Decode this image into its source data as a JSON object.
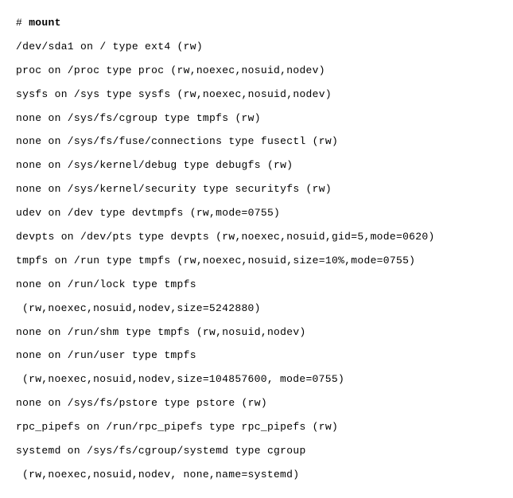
{
  "prompt": {
    "symbol": "# ",
    "command": "mount"
  },
  "lines": [
    {
      "text": "/dev/sda1 on / type ext4 (rw)",
      "indent": false
    },
    {
      "text": "proc on /proc type proc (rw,noexec,nosuid,nodev)",
      "indent": false
    },
    {
      "text": "sysfs on /sys type sysfs (rw,noexec,nosuid,nodev)",
      "indent": false
    },
    {
      "text": "none on /sys/fs/cgroup type tmpfs (rw)",
      "indent": false
    },
    {
      "text": "none on /sys/fs/fuse/connections type fusectl (rw)",
      "indent": false
    },
    {
      "text": "none on /sys/kernel/debug type debugfs (rw)",
      "indent": false
    },
    {
      "text": "none on /sys/kernel/security type securityfs (rw)",
      "indent": false
    },
    {
      "text": "udev on /dev type devtmpfs (rw,mode=0755)",
      "indent": false
    },
    {
      "text": "devpts on /dev/pts type devpts (rw,noexec,nosuid,gid=5,mode=0620)",
      "indent": false
    },
    {
      "text": "tmpfs on /run type tmpfs (rw,noexec,nosuid,size=10%,mode=0755)",
      "indent": false
    },
    {
      "text": "none on /run/lock type tmpfs",
      "indent": false
    },
    {
      "text": "(rw,noexec,nosuid,nodev,size=5242880)",
      "indent": true
    },
    {
      "text": "none on /run/shm type tmpfs (rw,nosuid,nodev)",
      "indent": false
    },
    {
      "text": "none on /run/user type tmpfs",
      "indent": false
    },
    {
      "text": "(rw,noexec,nosuid,nodev,size=104857600, mode=0755)",
      "indent": true
    },
    {
      "text": "none on /sys/fs/pstore type pstore (rw)",
      "indent": false
    },
    {
      "text": "rpc_pipefs on /run/rpc_pipefs type rpc_pipefs (rw)",
      "indent": false
    },
    {
      "text": "systemd on /sys/fs/cgroup/systemd type cgroup",
      "indent": false
    },
    {
      "text": "(rw,noexec,nosuid,nodev, none,name=systemd)",
      "indent": true
    }
  ]
}
